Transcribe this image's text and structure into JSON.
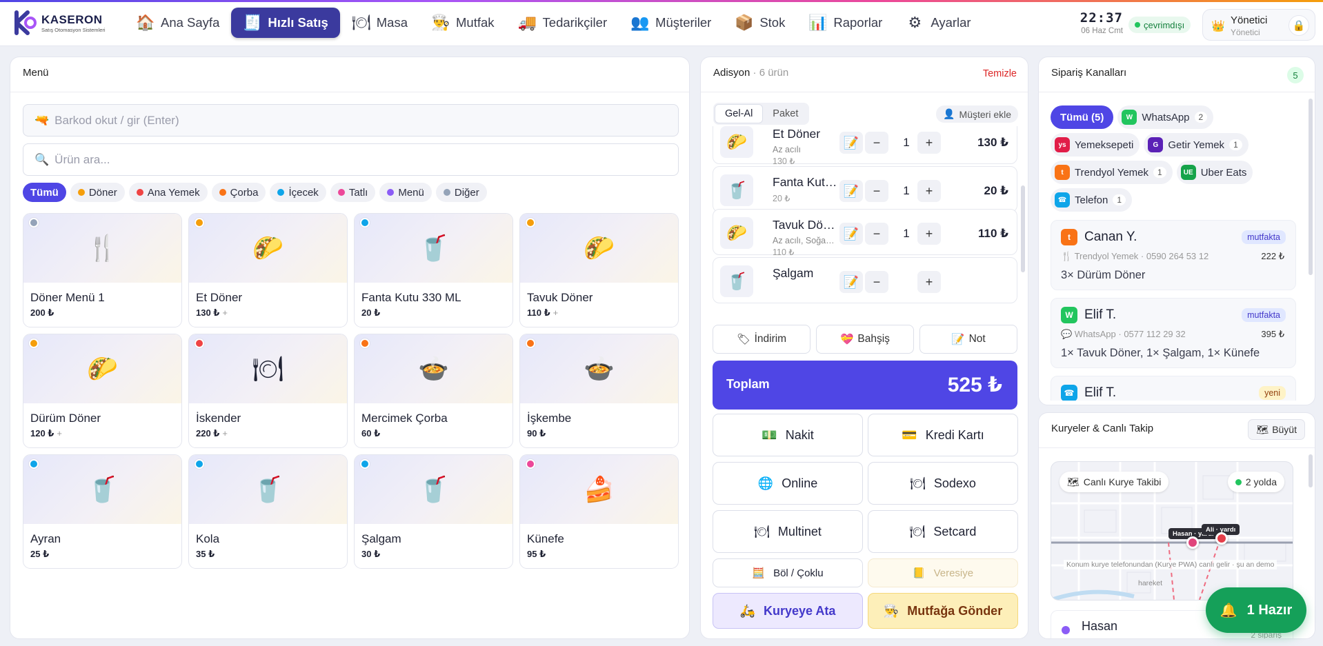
{
  "brand": {
    "name": "KASERON",
    "subtitle": "Satış Otomasyon Sistemleri"
  },
  "nav": [
    {
      "label": "Ana Sayfa",
      "icon": "house-icon",
      "glyph": "🏠"
    },
    {
      "label": "Hızlı Satış",
      "icon": "receipt-icon",
      "glyph": "🧾",
      "active": true
    },
    {
      "label": "Masa",
      "icon": "plate-icon",
      "glyph": "🍽"
    },
    {
      "label": "Mutfak",
      "icon": "chef-icon",
      "glyph": "👨‍🍳"
    },
    {
      "label": "Tedarikçiler",
      "icon": "truck-icon",
      "glyph": "🚚"
    },
    {
      "label": "Müşteriler",
      "icon": "people-icon",
      "glyph": "👥"
    },
    {
      "label": "Stok",
      "icon": "box-icon",
      "glyph": "📦"
    },
    {
      "label": "Raporlar",
      "icon": "chart-icon",
      "glyph": "📊"
    },
    {
      "label": "Ayarlar",
      "icon": "gear-icon",
      "glyph": "⚙"
    }
  ],
  "clock": {
    "time": "22:37",
    "date": "06 Haz Cmt"
  },
  "status": "çevrimdışı",
  "user": {
    "name": "Yönetici",
    "role": "Yönetici"
  },
  "menu": {
    "title": "Menü",
    "barcode_placeholder": "Barkod okut / gir (Enter)",
    "search_placeholder": "Ürün ara...",
    "categories": [
      {
        "label": "Tümü",
        "color": "",
        "active": true
      },
      {
        "label": "Döner",
        "color": "#f59e0b"
      },
      {
        "label": "Ana Yemek",
        "color": "#ef4444"
      },
      {
        "label": "Çorba",
        "color": "#f97316"
      },
      {
        "label": "İçecek",
        "color": "#0ea5e9"
      },
      {
        "label": "Tatlı",
        "color": "#ec4899"
      },
      {
        "label": "Menü",
        "color": "#8b5cf6"
      },
      {
        "label": "Diğer",
        "color": "#94a3b8"
      }
    ],
    "products": [
      {
        "name": "Döner Menü 1",
        "price": "200 ₺",
        "plus": "",
        "dot": "#94a3b8",
        "icon": "fork-knife-icon",
        "glyph": "🍴"
      },
      {
        "name": "Et Döner",
        "price": "130 ₺",
        "plus": "+",
        "dot": "#f59e0b",
        "icon": "taco-icon",
        "glyph": "🌮"
      },
      {
        "name": "Fanta Kutu 330 ML",
        "price": "20 ₺",
        "plus": "",
        "dot": "#0ea5e9",
        "icon": "cup-icon",
        "glyph": "🥤"
      },
      {
        "name": "Tavuk Döner",
        "price": "110 ₺",
        "plus": "+",
        "dot": "#f59e0b",
        "icon": "taco-icon",
        "glyph": "🌮"
      },
      {
        "name": "Dürüm Döner",
        "price": "120 ₺",
        "plus": "+",
        "dot": "#f59e0b",
        "icon": "taco-icon",
        "glyph": "🌮"
      },
      {
        "name": "İskender",
        "price": "220 ₺",
        "plus": "+",
        "dot": "#ef4444",
        "icon": "plate-icon",
        "glyph": "🍽"
      },
      {
        "name": "Mercimek Çorba",
        "price": "60 ₺",
        "plus": "",
        "dot": "#f97316",
        "icon": "soup-icon",
        "glyph": "🍲"
      },
      {
        "name": "İşkembe",
        "price": "90 ₺",
        "plus": "",
        "dot": "#f97316",
        "icon": "soup-icon",
        "glyph": "🍲"
      },
      {
        "name": "Ayran",
        "price": "25 ₺",
        "plus": "",
        "dot": "#0ea5e9",
        "icon": "cup-icon",
        "glyph": "🥤"
      },
      {
        "name": "Kola",
        "price": "35 ₺",
        "plus": "",
        "dot": "#0ea5e9",
        "icon": "cup-icon",
        "glyph": "🥤"
      },
      {
        "name": "Şalgam",
        "price": "30 ₺",
        "plus": "",
        "dot": "#0ea5e9",
        "icon": "cup-icon",
        "glyph": "🥤"
      },
      {
        "name": "Künefe",
        "price": "95 ₺",
        "plus": "",
        "dot": "#ec4899",
        "icon": "cake-icon",
        "glyph": "🍰"
      }
    ]
  },
  "adisyon": {
    "title": "Adisyon",
    "count": "· 6 ürün",
    "clear": "Temizle",
    "modes": [
      "Gel-Al",
      "Paket"
    ],
    "add_customer": "Müşteri ekle",
    "lines": [
      {
        "name": "Et Döner",
        "note": "Az acılı",
        "unit": "130 ₺",
        "qty": "1",
        "total": "130 ₺",
        "glyph": "🌮"
      },
      {
        "name": "Fanta Kut…",
        "note": "",
        "unit": "20 ₺",
        "qty": "1",
        "total": "20 ₺",
        "glyph": "🥤"
      },
      {
        "name": "Tavuk Dö…",
        "note": "Az acılı, Soğa…",
        "unit": "110 ₺",
        "qty": "1",
        "total": "110 ₺",
        "glyph": "🌮"
      },
      {
        "name": "Şalgam",
        "note": "",
        "unit": "",
        "qty": "",
        "total": "",
        "glyph": "🥤"
      }
    ],
    "extras": [
      {
        "label": "İndirim",
        "glyph": "🏷"
      },
      {
        "label": "Bahşiş",
        "glyph": "💝"
      },
      {
        "label": "Not",
        "glyph": "📝"
      }
    ],
    "total_label": "Toplam",
    "total_value": "525 ₺",
    "payments": [
      {
        "label": "Nakit",
        "glyph": "💵"
      },
      {
        "label": "Kredi Kartı",
        "glyph": "💳"
      },
      {
        "label": "Online",
        "glyph": "🌐"
      },
      {
        "label": "Sodexo",
        "glyph": "🍽"
      },
      {
        "label": "Multinet",
        "glyph": "🍽"
      },
      {
        "label": "Setcard",
        "glyph": "🍽"
      }
    ],
    "split": "Böl / Çoklu",
    "credit": "Veresiye",
    "courier": "Kuryeye Ata",
    "kitchen": "Mutfağa Gönder"
  },
  "channels": {
    "title": "Sipariş Kanalları",
    "count": "5",
    "chips": [
      {
        "label": "Tümü (5)",
        "active": true
      },
      {
        "label": "WhatsApp",
        "count": "2",
        "logo": "W",
        "color": "#22c55e"
      },
      {
        "label": "Yemeksepeti",
        "count": "",
        "logo": "ys",
        "color": "#e11d48"
      },
      {
        "label": "Getir Yemek",
        "count": "1",
        "logo": "G",
        "color": "#5b21b6"
      },
      {
        "label": "Trendyol Yemek",
        "count": "1",
        "logo": "t",
        "color": "#f97316"
      },
      {
        "label": "Uber Eats",
        "count": "",
        "logo": "UE",
        "color": "#16a34a"
      },
      {
        "label": "Telefon",
        "count": "1",
        "logo": "☎",
        "color": "#0ea5e9"
      }
    ],
    "orders": [
      {
        "name": "Canan Y.",
        "badge": "mutfakta",
        "meta": "🍴 Trendyol Yemek · 0590 264 53 12",
        "amount": "222 ₺",
        "items": "3× Dürüm Döner",
        "logo": "t",
        "color": "#f97316"
      },
      {
        "name": "Elif T.",
        "badge": "mutfakta",
        "meta": "💬 WhatsApp · 0577 112 29 32",
        "amount": "395 ₺",
        "items": "1× Tavuk Döner, 1× Şalgam, 1× Künefe",
        "logo": "W",
        "color": "#22c55e"
      },
      {
        "name": "Elif T.",
        "badge": "yeni",
        "meta": "",
        "amount": "",
        "items": "",
        "logo": "☎",
        "color": "#0ea5e9"
      }
    ]
  },
  "couriers": {
    "title": "Kuryeler & Canlı Takip",
    "expand": "Büyüt",
    "map_title": "Canlı Kurye Takibi",
    "on_way": "2 yolda",
    "pin1": "Hasan · yardı",
    "pin2": "Ali · yardı",
    "hint": "Konum kurye telefonundan (Kurye PWA) canlı gelir · şu an demo",
    "hint2": "hareket",
    "row_name": "Hasan",
    "row_sub": "2 sipariş"
  },
  "ready": "1 Hazır"
}
